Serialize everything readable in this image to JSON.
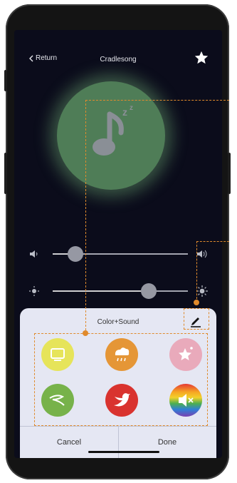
{
  "header": {
    "back_label": "Return",
    "title": "Cradlesong",
    "favorite_icon": "star-icon"
  },
  "player": {
    "artwork_icon": "music-note-sleep-icon",
    "artwork_color": "#4f7d57"
  },
  "sliders": [
    {
      "name": "volume",
      "left_icon": "speaker-low-icon",
      "right_icon": "speaker-high-icon",
      "value": 0.17
    },
    {
      "name": "brightness",
      "left_icon": "sun-low-icon",
      "right_icon": "sun-high-icon",
      "value": 0.71
    }
  ],
  "sheet": {
    "title": "Color+Sound",
    "edit_icon": "pencil-icon",
    "items": [
      {
        "icon": "tv-icon",
        "color": "#e6e45a"
      },
      {
        "icon": "rain-cloud-icon",
        "color": "#e59636"
      },
      {
        "icon": "star-sparkle-icon",
        "color": "#e9aabb"
      },
      {
        "icon": "wind-icon",
        "color": "#77b24a"
      },
      {
        "icon": "bird-icon",
        "color": "#d9332f"
      },
      {
        "icon": "mute-speaker-icon",
        "color": "rainbow"
      }
    ],
    "cancel_label": "Cancel",
    "done_label": "Done"
  },
  "annotation_color": "#e08a2c"
}
